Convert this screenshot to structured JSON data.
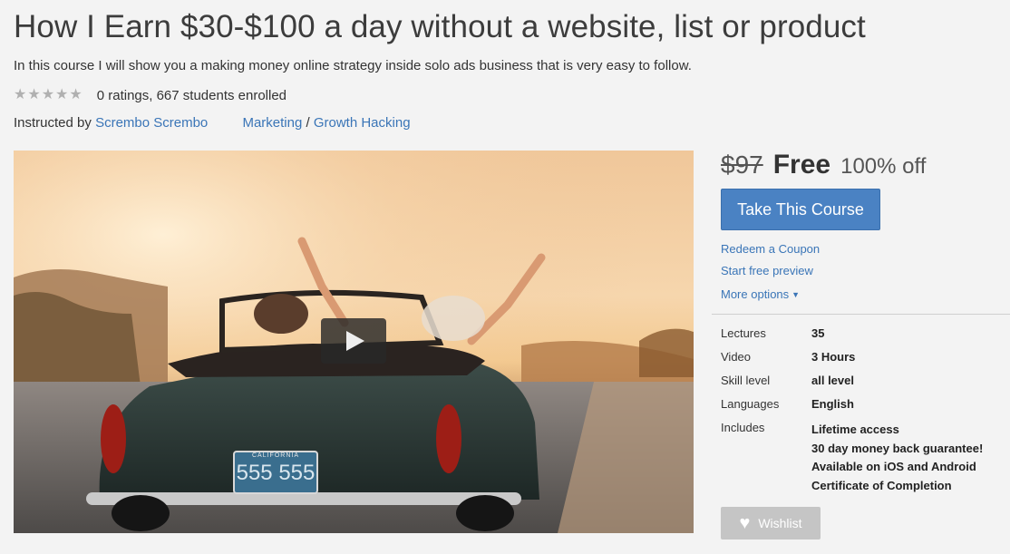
{
  "course": {
    "title": "How I Earn $30-$100 a day without a website, list or product",
    "subtitle": "In this course I will show you a making money online strategy inside solo ads business that is very easy to follow.",
    "rating_text": "0 ratings, 667 students enrolled",
    "rating_value": 0,
    "rating_max": 5,
    "instructed_by_label": "Instructed by",
    "instructor": "Scrembo Scrembo",
    "category": "Marketing",
    "category_sep": "/",
    "subcategory": "Growth Hacking"
  },
  "video": {
    "license_plate": "555 555",
    "plate_state": "CALIFORNIA"
  },
  "pricing": {
    "old_price": "$97",
    "new_price": "Free",
    "discount": "100% off",
    "take_course_label": "Take This Course"
  },
  "links": {
    "redeem": "Redeem a Coupon",
    "preview": "Start free preview",
    "more_options": "More options"
  },
  "specs": {
    "lectures_label": "Lectures",
    "lectures_value": "35",
    "video_label": "Video",
    "video_value": "3 Hours",
    "skill_label": "Skill level",
    "skill_value": "all level",
    "languages_label": "Languages",
    "languages_value": "English",
    "includes_label": "Includes",
    "includes": [
      "Lifetime access",
      "30 day money back guarantee!",
      "Available on iOS and Android",
      "Certificate of Completion"
    ]
  },
  "wishlist_label": "Wishlist",
  "colors": {
    "link": "#3a75b7",
    "button": "#4a82c3",
    "wishlist_bg": "#c5c5c5"
  }
}
